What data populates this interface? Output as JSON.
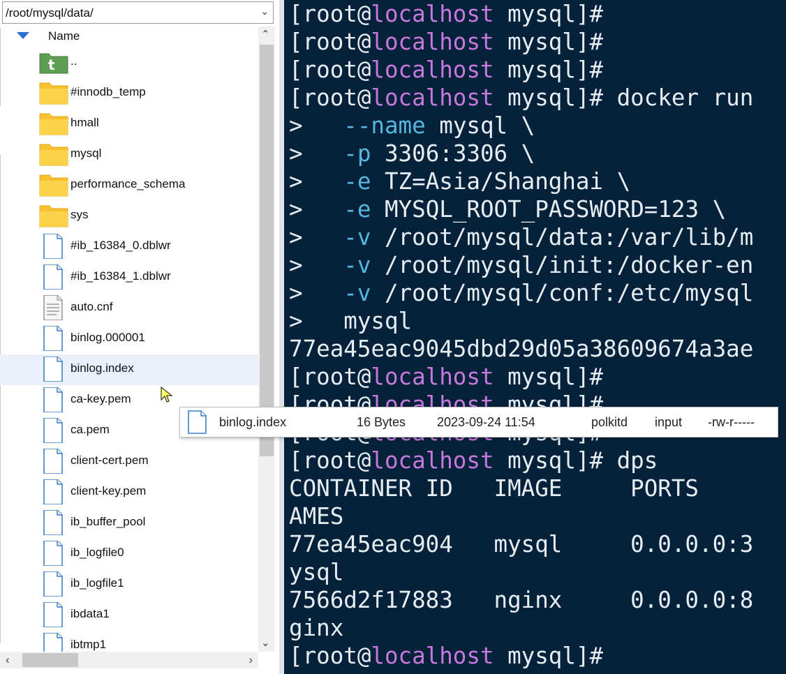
{
  "file_panel": {
    "path": "/root/mysql/data/",
    "column_header": "Name",
    "files": [
      {
        "name": "..",
        "kind": "parent-folder-icon"
      },
      {
        "name": "#innodb_temp",
        "kind": "folder-icon"
      },
      {
        "name": "hmall",
        "kind": "folder-icon"
      },
      {
        "name": "mysql",
        "kind": "folder-icon"
      },
      {
        "name": "performance_schema",
        "kind": "folder-icon"
      },
      {
        "name": "sys",
        "kind": "folder-icon"
      },
      {
        "name": "#ib_16384_0.dblwr",
        "kind": "file-icon"
      },
      {
        "name": "#ib_16384_1.dblwr",
        "kind": "file-icon"
      },
      {
        "name": "auto.cnf",
        "kind": "text-file-icon"
      },
      {
        "name": "binlog.000001",
        "kind": "file-icon"
      },
      {
        "name": "binlog.index",
        "kind": "file-icon",
        "selected": true
      },
      {
        "name": "ca-key.pem",
        "kind": "file-icon"
      },
      {
        "name": "ca.pem",
        "kind": "file-icon"
      },
      {
        "name": "client-cert.pem",
        "kind": "file-icon"
      },
      {
        "name": "client-key.pem",
        "kind": "file-icon"
      },
      {
        "name": "ib_buffer_pool",
        "kind": "file-icon"
      },
      {
        "name": "ib_logfile0",
        "kind": "file-icon"
      },
      {
        "name": "ib_logfile1",
        "kind": "file-icon"
      },
      {
        "name": "ibdata1",
        "kind": "file-icon"
      },
      {
        "name": "ibtmp1",
        "kind": "file-icon"
      }
    ]
  },
  "tooltip": {
    "name": "binlog.index",
    "size": "16 Bytes",
    "modified": "2023-09-24 11:54",
    "owner": "polkitd",
    "group": "input",
    "permissions": "-rw-r-----"
  },
  "terminal": {
    "colors": {
      "background": "#06223a",
      "host": "#c678dd",
      "option": "#56b6e0",
      "text": "#e6edf3"
    },
    "prompt": {
      "open": "[root@",
      "host": "localhost",
      "close": " mysql]#"
    },
    "lines": [
      {
        "prompt": true,
        "cmd": ""
      },
      {
        "prompt": true,
        "cmd": ""
      },
      {
        "prompt": true,
        "cmd": ""
      },
      {
        "prompt": true,
        "cmd": " docker run"
      },
      {
        "cont": ">   ",
        "opt": "--name",
        "rest": " mysql \\"
      },
      {
        "cont": ">   ",
        "opt": "-p",
        "rest": " 3306:3306 \\"
      },
      {
        "cont": ">   ",
        "opt": "-e",
        "rest": " TZ=Asia/Shanghai \\"
      },
      {
        "cont": ">   ",
        "opt": "-e",
        "rest": " MYSQL_ROOT_PASSWORD=123 \\"
      },
      {
        "cont": ">   ",
        "opt": "-v",
        "rest": " /root/mysql/data:/var/lib/m"
      },
      {
        "cont": ">   ",
        "opt": "-v",
        "rest": " /root/mysql/init:/docker-en"
      },
      {
        "cont": ">   ",
        "opt": "-v",
        "rest": " /root/mysql/conf:/etc/mysql"
      },
      {
        "cont": ">   ",
        "opt": "",
        "rest": "mysql"
      },
      {
        "text": "77ea45eac9045dbd29d05a38609674a3ae"
      },
      {
        "prompt": true,
        "cmd": ""
      },
      {
        "prompt": true,
        "cmd": ""
      },
      {
        "prompt": true,
        "cmd": ""
      },
      {
        "prompt": true,
        "cmd": " dps"
      },
      {
        "text": "CONTAINER ID   IMAGE     PORTS"
      },
      {
        "text": "AMES"
      },
      {
        "text": "77ea45eac904   mysql     0.0.0.0:3"
      },
      {
        "text": "ysql"
      },
      {
        "text": "7566d2f17883   nginx     0.0.0.0:8"
      },
      {
        "text": "ginx"
      },
      {
        "prompt": true,
        "cmd": ""
      },
      {
        "prompt": true,
        "cmd": ""
      }
    ]
  }
}
